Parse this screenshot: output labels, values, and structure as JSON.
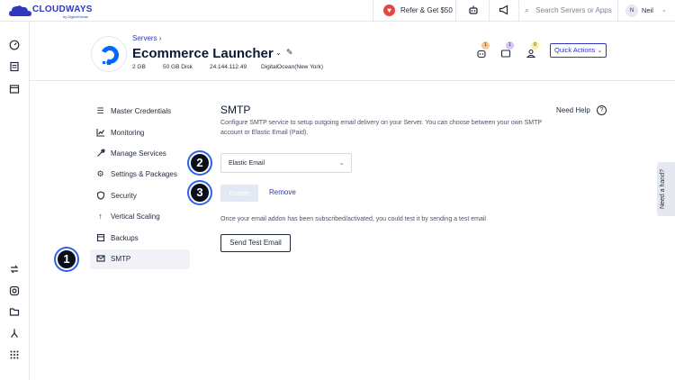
{
  "topbar": {
    "logo_text": "CLOUDWAYS",
    "logo_sub": "by DigitalOcean",
    "refer_label": "Refer & Get $50",
    "search_placeholder": "Search Servers or Apps",
    "user_initial": "N",
    "user_name": "Neil"
  },
  "leftnav": {
    "icons": [
      "speedometer-icon",
      "server-list-icon",
      "window-icon",
      "transfer-icon",
      "settings-gear-icon",
      "folder-icon",
      "merge-icon",
      "apps-grid-icon"
    ]
  },
  "server": {
    "breadcrumb": "Servers",
    "name": "Ecommerce Launcher",
    "ram": "2 GB",
    "disk": "50 GB Disk",
    "ip": "24.144.112.49",
    "provider": "DigitalOcean(New York)",
    "badges": [
      "1",
      "1",
      "0"
    ],
    "quick_actions": "Quick Actions",
    "brand_color": "#0069ff"
  },
  "menu": [
    {
      "label": "Master Credentials",
      "icon": "list-icon"
    },
    {
      "label": "Monitoring",
      "icon": "chart-icon"
    },
    {
      "label": "Manage Services",
      "icon": "wrench-icon"
    },
    {
      "label": "Settings & Packages",
      "icon": "gear-icon"
    },
    {
      "label": "Security",
      "icon": "shield-icon"
    },
    {
      "label": "Vertical Scaling",
      "icon": "arrow-up-icon"
    },
    {
      "label": "Backups",
      "icon": "backup-icon"
    },
    {
      "label": "SMTP",
      "icon": "mail-icon",
      "active": true
    }
  ],
  "smtp": {
    "title": "SMTP",
    "need_help": "Need Help",
    "description": "Configure SMTP service to setup outgoing email delivery on your Server. You can choose between your own SMTP account or Elastic Email (Paid).",
    "selected": "Elastic Email",
    "enable": "Enable",
    "remove": "Remove",
    "info": "Once your email addon has been subscribed/activated, you could test it by sending a test email",
    "test_button": "Send Test Email"
  },
  "callouts": [
    "1",
    "2",
    "3"
  ],
  "hand_tab": "Need a hand?",
  "colors": {
    "accent": "#2c39bd",
    "callout_ring": "#2c62e8",
    "badge_orange": "#fbc98f",
    "badge_purple": "#d9c3f5",
    "badge_yellow": "#fdf0a6"
  }
}
